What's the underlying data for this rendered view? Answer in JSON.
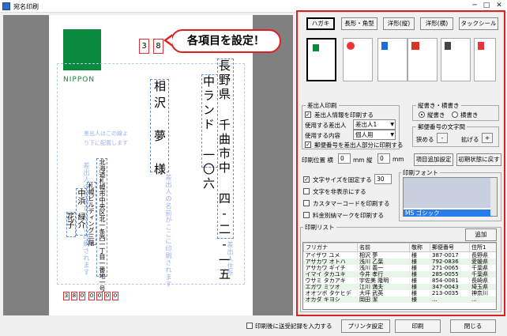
{
  "window": {
    "title": "宛名印刷",
    "min": "─",
    "max": "□",
    "close": "✕"
  },
  "callout": "各項目を設定！",
  "preview": {
    "logo_text": "NIPPON",
    "zip_top": [
      "3",
      "8"
    ],
    "address_line1": "長野県 千曲市中 四-二-一五",
    "address_line2": "中ランド 一〇六",
    "recipient": "相沢　夢　様",
    "note": "差出人はこの線より下に配置します",
    "sender_note": "差出人住所",
    "sender_addr_note": "差出人の住所がここに印刷されます",
    "sender_name_note": "差出人の名前がここに印刷されます",
    "sender_addr": "北海道札幌市中央区北一条西一丁目一番地一号",
    "sender_addr2": "札幌ビルディング三階",
    "sender_name": "中浜　緑介",
    "sender_name2": "花子",
    "zip_bottom": [
      "3",
      "8",
      "0",
      "0",
      "0",
      "0",
      "0"
    ]
  },
  "panel": {
    "types": [
      "ハガキ",
      "長形・角型",
      "洋形(縦)",
      "洋形(横)",
      "タックシール"
    ],
    "sender_group": {
      "label": "差出人印刷",
      "print_info_label": "差出人情報を印刷する",
      "use_sender_label": "使用する差出人",
      "use_sender_value": "差出人1",
      "use_content_label": "使用する内容",
      "use_content_value": "個人用",
      "zip_in_sender_label": "郵便番号を差出人部分に印刷する"
    },
    "orient_group": {
      "label": "縦書き・横書き",
      "vertical": "縦書き",
      "horizontal": "横書き"
    },
    "zip_spacing_group": {
      "label": "郵便番号の文字間",
      "narrow": "狭める",
      "narrow_btn": "-",
      "widen": "拡げる",
      "widen_btn": "+"
    },
    "position": {
      "label": "印刷位置 横",
      "x": "0",
      "mm1": "mm 縦",
      "y": "0",
      "mm2": "mm"
    },
    "add_item_button": "項目追加設定",
    "reset_button": "初期状態に戻す",
    "options": {
      "fix_size": "文字サイズを固定する",
      "fix_size_value": "30",
      "hide_text": "文字を非表示にする",
      "customer_code": "カスタマーコードを印刷する",
      "postage_mark": "料金別納マークを印刷する"
    },
    "font_group": {
      "label": "印刷フォント",
      "selected_font": "MS ゴシック"
    },
    "list_group": {
      "label": "印刷リスト",
      "add_button": "追加",
      "columns": [
        "フリガナ",
        "名前",
        "敬称",
        "郵便番号",
        "住所1"
      ],
      "rows": [
        [
          "アイザワ ユメ",
          "相沢 夢",
          "様",
          "387-0017",
          "長野県"
        ],
        [
          "アサカワ オトハ",
          "浅川 乙葉",
          "様",
          "792-0836",
          "愛媛県"
        ],
        [
          "アサカワ ギイチ",
          "浅川 義一",
          "様",
          "271-0065",
          "千葉県"
        ],
        [
          "イマイ タカユキ",
          "今井 孝行",
          "様",
          "285-0055",
          "千葉県"
        ],
        [
          "ウサミ タカアキ",
          "宇佐美 隆明",
          "様",
          "854-0081",
          "長崎県"
        ],
        [
          "エガワ ミツオ",
          "江川 満夫",
          "様",
          "347-0043",
          "埼玉県"
        ],
        [
          "オオツボ タケヒデ",
          "大坪 武英",
          "様",
          "213-0035",
          "神奈川"
        ],
        [
          "オカダ キヨシ",
          "岡田 潔",
          "様",
          "...",
          "..."
        ]
      ]
    }
  },
  "bottom": {
    "record_label": "印刷後に送受記録を入力する",
    "printer_button": "プリンタ設定",
    "print_button": "印刷",
    "close_button": "閉じる"
  }
}
